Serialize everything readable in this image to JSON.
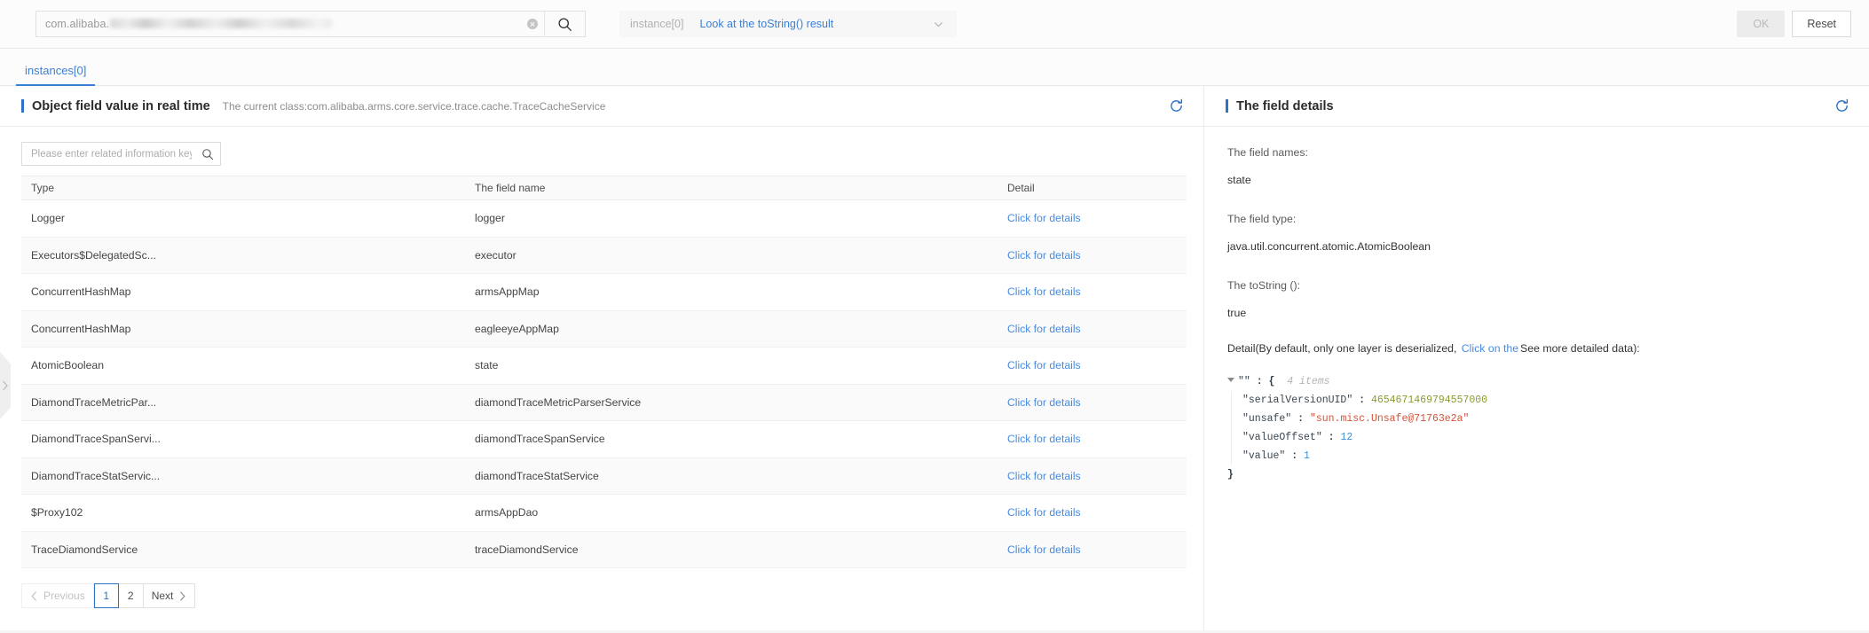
{
  "topbar": {
    "search": {
      "prefix_text": "com.alibaba.",
      "masked": true,
      "clear_icon": "clear-circle-icon",
      "search_icon": "search-icon"
    },
    "instance_selector": {
      "label": "instance[0]",
      "value": "Look at the toString() result",
      "chevron_icon": "chevron-down-icon"
    },
    "ok_label": "OK",
    "reset_label": "Reset"
  },
  "tabs": [
    {
      "label": "instances[0]",
      "active": true
    }
  ],
  "left_panel": {
    "title": "Object field value in real time",
    "subtitle": "The current class:com.alibaba.arms.core.service.trace.cache.TraceCacheService",
    "refresh_icon": "refresh-icon",
    "search_placeholder": "Please enter related information keyword s",
    "search_value": "",
    "columns": [
      "Type",
      "The field name",
      "Detail"
    ],
    "detail_link_label": "Click for details",
    "rows": [
      {
        "type": "Logger",
        "field": "logger"
      },
      {
        "type": "Executors$DelegatedSc...",
        "field": "executor"
      },
      {
        "type": "ConcurrentHashMap",
        "field": "armsAppMap"
      },
      {
        "type": "ConcurrentHashMap",
        "field": "eagleeyeAppMap"
      },
      {
        "type": "AtomicBoolean",
        "field": "state"
      },
      {
        "type": "DiamondTraceMetricPar...",
        "field": "diamondTraceMetricParserService"
      },
      {
        "type": "DiamondTraceSpanServi...",
        "field": "diamondTraceSpanService"
      },
      {
        "type": "DiamondTraceStatServic...",
        "field": "diamondTraceStatService"
      },
      {
        "type": "$Proxy102",
        "field": "armsAppDao"
      },
      {
        "type": "TraceDiamondService",
        "field": "traceDiamondService"
      }
    ],
    "pagination": {
      "previous_label": "Previous",
      "next_label": "Next",
      "pages": [
        "1",
        "2"
      ],
      "current_page": "1"
    }
  },
  "right_panel": {
    "title": "The field details",
    "refresh_icon": "refresh-icon",
    "field_names_label": "The field names:",
    "field_names_value": "state",
    "field_type_label": "The field type:",
    "field_type_value": "java.util.concurrent.atomic.AtomicBoolean",
    "tostring_label": "The toString ():",
    "tostring_value": "true",
    "detail_note_prefix": "Detail(By default, only one layer is deserialized,",
    "detail_note_link": "Click on the",
    "detail_note_suffix": "See more detailed data):",
    "json_tree": {
      "root_key": "\"\"",
      "root_open": "{",
      "items_count": "4 items",
      "root_close": "}",
      "entries": [
        {
          "key": "\"serialVersionUID\"",
          "value": "4654671469794557000",
          "kind": "long"
        },
        {
          "key": "\"unsafe\"",
          "value": "\"sun.misc.Unsafe@71763e2a\"",
          "kind": "string"
        },
        {
          "key": "\"valueOffset\"",
          "value": "12",
          "kind": "number"
        },
        {
          "key": "\"value\"",
          "value": "1",
          "kind": "number"
        }
      ]
    }
  },
  "collapse_handle_icon": "chevron-right-icon",
  "colors": {
    "accent": "#2d72c8",
    "link": "#4a8bdd",
    "string": "#d4543a",
    "number": "#3b8fd4",
    "long": "#8a9a32"
  }
}
